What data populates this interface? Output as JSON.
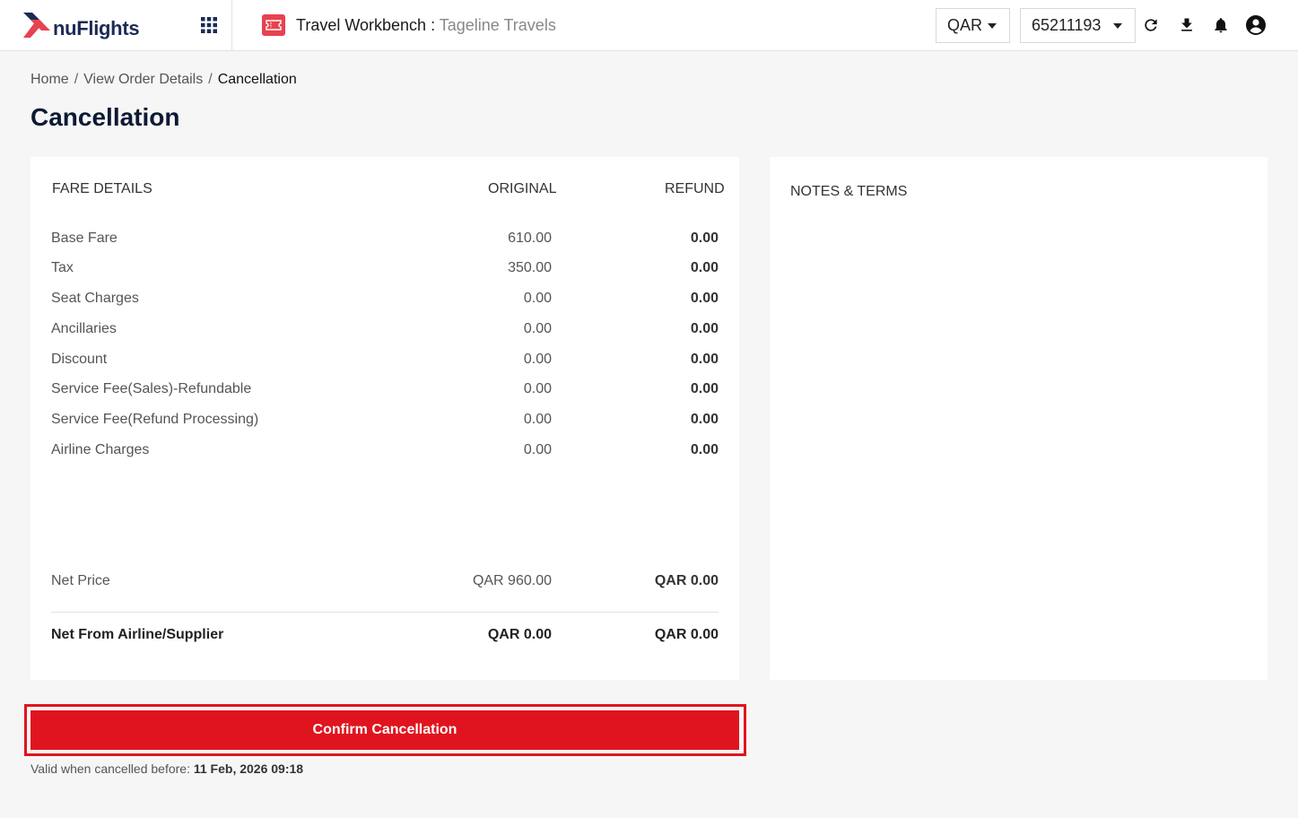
{
  "header": {
    "brand": "nuFlights",
    "app_name": "Travel Workbench",
    "separator": " : ",
    "agency": "Tageline Travels",
    "currency": "QAR",
    "account": "65211193",
    "colors": {
      "brand_red": "#e8414f",
      "brand_navy": "#1d2a55"
    },
    "icons": [
      "apps-grid-icon",
      "refresh-icon",
      "download-icon",
      "bell-icon",
      "account-circle-icon"
    ]
  },
  "breadcrumb": {
    "items": [
      "Home",
      "View Order Details"
    ],
    "separator": "/",
    "current": "Cancellation"
  },
  "page_title": "Cancellation",
  "fare": {
    "headers": {
      "label": "FARE DETAILS",
      "original": "ORIGINAL",
      "refund": "REFUND"
    },
    "rows": [
      {
        "label": "Base Fare",
        "original": "610.00",
        "refund": "0.00"
      },
      {
        "label": "Tax",
        "original": "350.00",
        "refund": "0.00"
      },
      {
        "label": "Seat Charges",
        "original": "0.00",
        "refund": "0.00"
      },
      {
        "label": "Ancillaries",
        "original": "0.00",
        "refund": "0.00"
      },
      {
        "label": "Discount",
        "original": "0.00",
        "refund": "0.00"
      },
      {
        "label": "Service Fee(Sales)-Refundable",
        "original": "0.00",
        "refund": "0.00"
      },
      {
        "label": "Service Fee(Refund Processing)",
        "original": "0.00",
        "refund": "0.00"
      },
      {
        "label": "Airline Charges",
        "original": "0.00",
        "refund": "0.00"
      }
    ],
    "net_price": {
      "label": "Net Price",
      "original": "QAR 960.00",
      "refund": "QAR 0.00"
    },
    "net_supplier": {
      "label": "Net From Airline/Supplier",
      "original": "QAR 0.00",
      "refund": "QAR 0.00"
    }
  },
  "notes": {
    "title": "NOTES & TERMS"
  },
  "confirm": {
    "label": "Confirm Cancellation",
    "validity_prefix": "Valid when cancelled before: ",
    "validity_date": "11 Feb, 2026 09:18",
    "color": "#e0141e"
  }
}
